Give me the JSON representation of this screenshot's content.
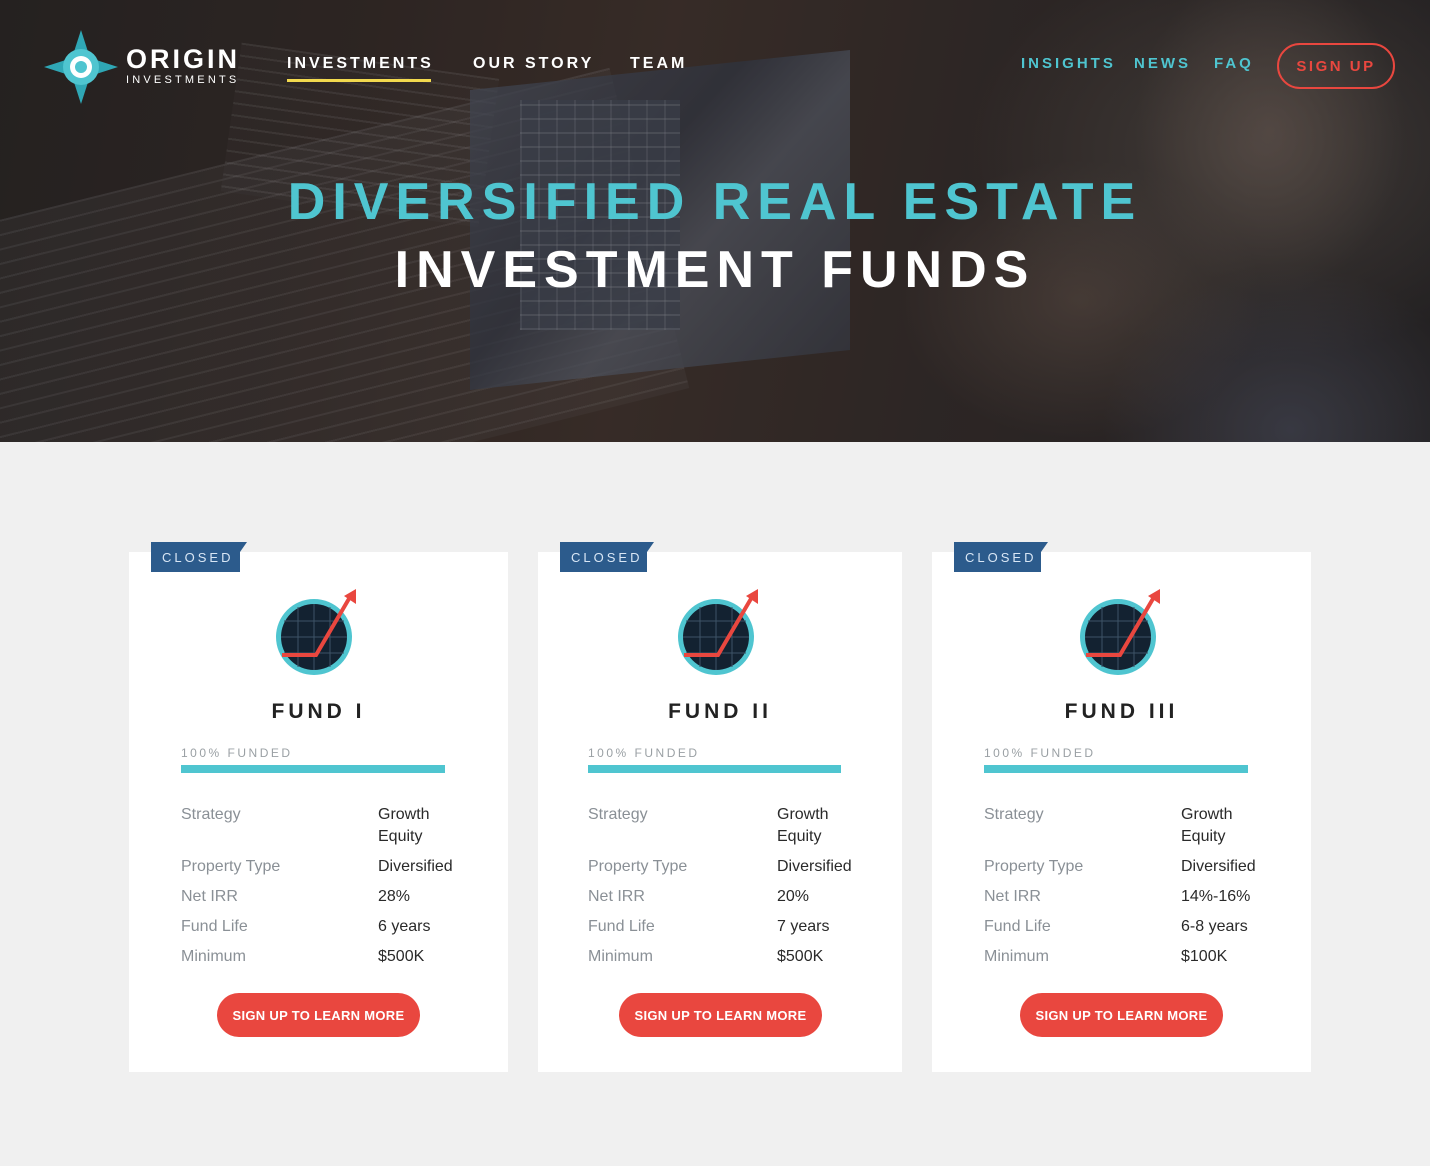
{
  "brand": {
    "name": "ORIGIN",
    "subtitle": "INVESTMENTS"
  },
  "nav": {
    "main": [
      "INVESTMENTS",
      "OUR STORY",
      "TEAM"
    ],
    "secondary": [
      "INSIGHTS",
      "NEWS",
      "FAQ"
    ],
    "signup": "SIGN UP"
  },
  "hero": {
    "line1": "DIVERSIFIED REAL ESTATE",
    "line2": "INVESTMENT FUNDS"
  },
  "funds": [
    {
      "status": "CLOSED",
      "name": "FUND I",
      "funded_label": "100% FUNDED",
      "funded_fraction": 1.0,
      "specs": [
        {
          "key": "Strategy",
          "value": "Growth Equity"
        },
        {
          "key": "Property Type",
          "value": "Diversified"
        },
        {
          "key": "Net IRR",
          "value": "28%"
        },
        {
          "key": "Fund Life",
          "value": "6 years"
        },
        {
          "key": "Minimum",
          "value": "$500K"
        }
      ],
      "cta": "SIGN UP TO LEARN MORE"
    },
    {
      "status": "CLOSED",
      "name": "FUND II",
      "funded_label": "100% FUNDED",
      "funded_fraction": 1.0,
      "specs": [
        {
          "key": "Strategy",
          "value": "Growth Equity"
        },
        {
          "key": "Property Type",
          "value": "Diversified"
        },
        {
          "key": "Net IRR",
          "value": "20%"
        },
        {
          "key": "Fund Life",
          "value": "7 years"
        },
        {
          "key": "Minimum",
          "value": "$500K"
        }
      ],
      "cta": "SIGN UP TO LEARN MORE"
    },
    {
      "status": "CLOSED",
      "name": "FUND III",
      "funded_label": "100% FUNDED",
      "funded_fraction": 1.0,
      "specs": [
        {
          "key": "Strategy",
          "value": "Growth Equity"
        },
        {
          "key": "Property Type",
          "value": "Diversified"
        },
        {
          "key": "Net IRR",
          "value": "14%-16%"
        },
        {
          "key": "Fund Life",
          "value": "6-8 years"
        },
        {
          "key": "Minimum",
          "value": "$100K"
        }
      ],
      "cta": "SIGN UP TO LEARN MORE"
    }
  ],
  "colors": {
    "teal": "#4fc5d0",
    "coral": "#e9473f",
    "badge": "#2c5b8c",
    "active_underline": "#f2d94e"
  },
  "icons": {
    "logo": "compass-star-icon",
    "fund": "growth-chart-icon"
  }
}
